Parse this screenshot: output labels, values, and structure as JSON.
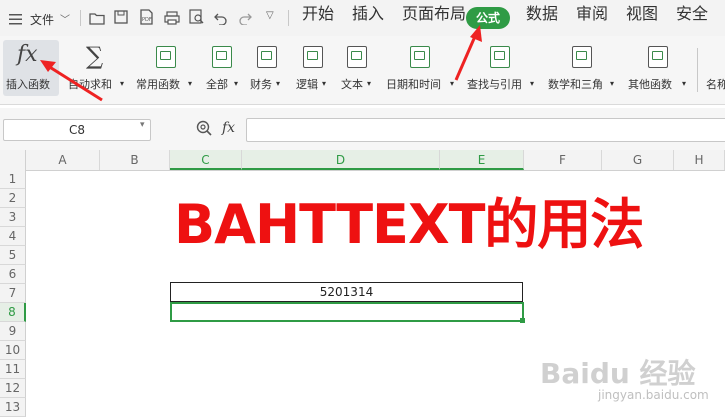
{
  "menubar": {
    "file_label": "文件",
    "tabs": [
      "开始",
      "插入",
      "页面布局",
      "公式",
      "数据",
      "审阅",
      "视图",
      "安全"
    ],
    "active_tab": "公式"
  },
  "ribbon": {
    "insert_function": "插入函数",
    "items": [
      "自动求和",
      "常用函数",
      "全部",
      "财务",
      "逻辑",
      "文本",
      "日期和时间",
      "查找与引用",
      "数学和三角",
      "其他函数"
    ],
    "cut_off_label": "名称"
  },
  "formula_bar": {
    "name_box": "C8",
    "fx_symbol": "fx",
    "formula": ""
  },
  "sheet": {
    "columns": [
      "A",
      "B",
      "C",
      "D",
      "E",
      "F",
      "G",
      "H"
    ],
    "rows": [
      "1",
      "2",
      "3",
      "4",
      "5",
      "6",
      "7",
      "8",
      "9",
      "10",
      "11",
      "12",
      "13"
    ],
    "selected_column": "C",
    "selected_row": "8",
    "cell_c7_value": "5201314"
  },
  "overlay_title": "BAHTTEXT的用法",
  "watermark": {
    "brand": "Baidu 经验",
    "url": "jingyan.baidu.com"
  },
  "colors": {
    "accent": "#2f9b45",
    "title": "#ee1111"
  }
}
